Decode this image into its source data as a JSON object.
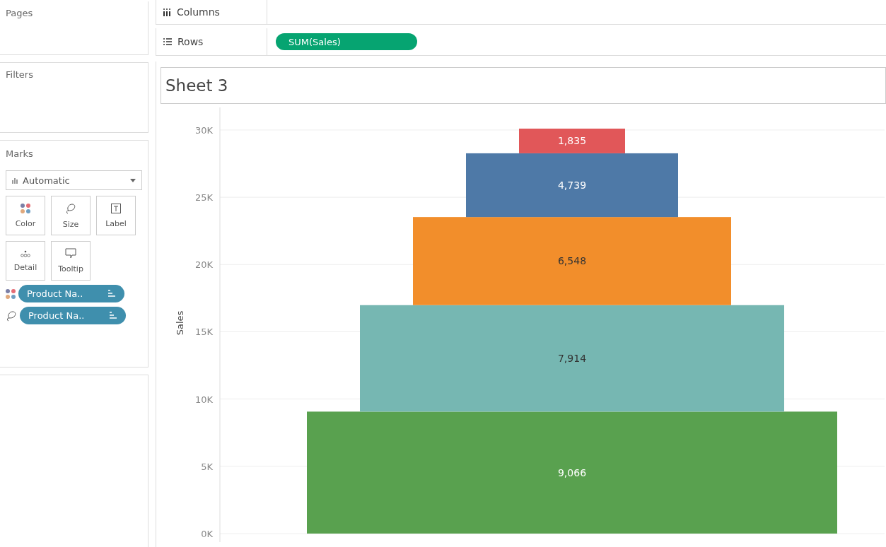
{
  "pages": {
    "title": "Pages"
  },
  "filters": {
    "title": "Filters"
  },
  "marks": {
    "title": "Marks",
    "mark_type": "Automatic",
    "cards": [
      {
        "kind": "color",
        "label": "Color"
      },
      {
        "kind": "size",
        "label": "Size"
      },
      {
        "kind": "label",
        "label": "Label"
      },
      {
        "kind": "detail",
        "label": "Detail"
      },
      {
        "kind": "tooltip",
        "label": "Tooltip"
      }
    ],
    "pills": [
      {
        "kind": "color",
        "label": "Product Na.."
      },
      {
        "kind": "size",
        "label": "Product Na.."
      }
    ]
  },
  "columns_shelf": {
    "label": "Columns"
  },
  "rows_shelf": {
    "label": "Rows",
    "pill": "SUM(Sales)"
  },
  "sheet": {
    "title": "Sheet 3",
    "chart_data": {
      "type": "bar",
      "stacked": true,
      "ylabel": "Sales",
      "ylim": [
        0,
        30102
      ],
      "grid": true,
      "value_labels": [
        "9,066",
        "7,914",
        "6,548",
        "4,739",
        "1,835"
      ],
      "yticks": [
        {
          "value": 0,
          "label": "0K"
        },
        {
          "value": 5000,
          "label": "5K"
        },
        {
          "value": 10000,
          "label": "10K"
        },
        {
          "value": 15000,
          "label": "15K"
        },
        {
          "value": 20000,
          "label": "20K"
        },
        {
          "value": 25000,
          "label": "25K"
        },
        {
          "value": 30000,
          "label": "30K"
        }
      ],
      "series": [
        {
          "color": "#59a14f",
          "values": [
            9066
          ]
        },
        {
          "color": "#76b7b2",
          "values": [
            7914
          ]
        },
        {
          "color": "#f28e2b",
          "values": [
            6548
          ]
        },
        {
          "color": "#4e79a7",
          "values": [
            4739
          ]
        },
        {
          "color": "#e15759",
          "values": [
            1835
          ]
        }
      ]
    }
  }
}
